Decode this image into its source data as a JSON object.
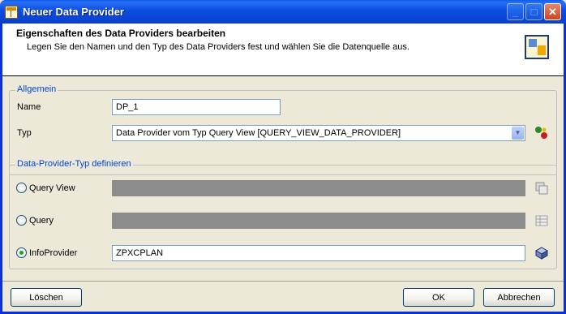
{
  "window": {
    "title": "Neuer Data Provider",
    "controls": {
      "minimize": "_",
      "maximize": "□",
      "close": "✕"
    }
  },
  "header": {
    "title": "Eigenschaften des Data Providers bearbeiten",
    "subtitle": "Legen Sie den Namen und den Typ des Data Providers fest und wählen Sie die Datenquelle aus."
  },
  "general": {
    "legend": "Allgemein",
    "name_label": "Name",
    "name_value": "DP_1",
    "type_label": "Typ",
    "type_value": "Data Provider vom Typ Query View [QUERY_VIEW_DATA_PROVIDER]"
  },
  "definition": {
    "legend": "Data-Provider-Typ definieren",
    "options": [
      {
        "label": "Query View",
        "value": "",
        "selected": false
      },
      {
        "label": "Query",
        "value": "",
        "selected": false
      },
      {
        "label": "InfoProvider",
        "value": "ZPXCPLAN",
        "selected": true
      }
    ]
  },
  "footer": {
    "delete_label": "Löschen",
    "ok_label": "OK",
    "cancel_label": "Abbrechen"
  },
  "colors": {
    "titlebar": "#0a5eea",
    "legend_text": "#0046d5",
    "disabled_field": "#8c8c8c"
  }
}
